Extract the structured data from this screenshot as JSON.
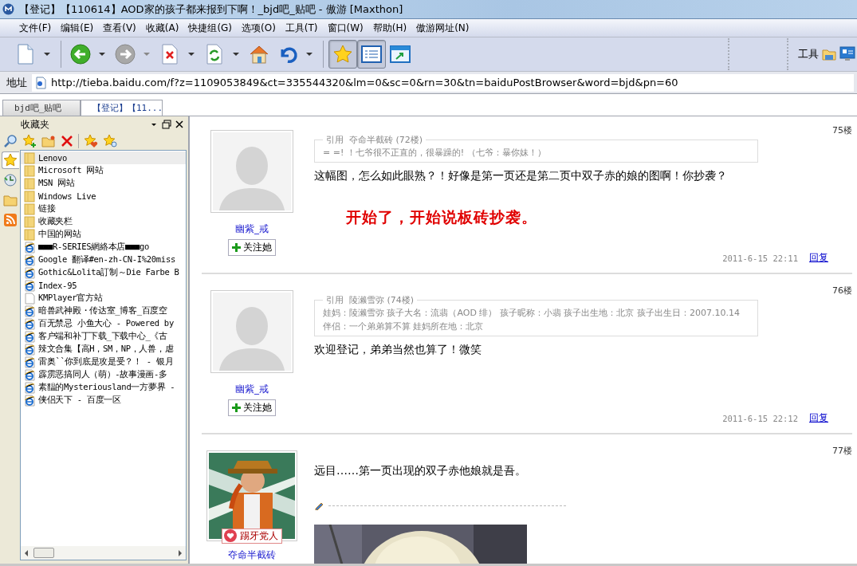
{
  "window": {
    "title": "【登记】【110614】AOD家的孩子都来报到下啊！_bjd吧_贴吧 - 傲游 [Maxthon]"
  },
  "menu": [
    "文件(F)",
    "编辑(E)",
    "查看(V)",
    "收藏(A)",
    "快捷组(G)",
    "选项(O)",
    "工具(T)",
    "窗口(W)",
    "帮助(H)",
    "傲游网址(N)"
  ],
  "toolbar": [
    {
      "kind": "new",
      "dropdown": true,
      "pressed": false,
      "separator": true
    },
    {
      "kind": "back",
      "dropdown": true,
      "pressed": false,
      "separator": false
    },
    {
      "kind": "forward",
      "dropdown": true,
      "pressed": false,
      "separator": false
    },
    {
      "kind": "stop",
      "dropdown": true,
      "pressed": false,
      "separator": false
    },
    {
      "kind": "refresh",
      "dropdown": true,
      "pressed": false,
      "separator": false
    },
    {
      "kind": "home",
      "dropdown": false,
      "pressed": false,
      "separator": false
    },
    {
      "kind": "undo",
      "dropdown": true,
      "pressed": false,
      "separator": true
    },
    {
      "kind": "favorites",
      "dropdown": false,
      "pressed": true,
      "separator": false
    },
    {
      "kind": "sidebar",
      "dropdown": false,
      "pressed": true,
      "separator": false
    },
    {
      "kind": "window",
      "dropdown": false,
      "pressed": false,
      "separator": false
    }
  ],
  "tools": {
    "label": "工具"
  },
  "address": {
    "label": "地址",
    "value": "http://tieba.baidu.com/f?z=1109053849&ct=335544320&lm=0&sc=0&rn=30&tn=baiduPostBrowser&word=bjd&pn=60"
  },
  "tabs": [
    {
      "label": "bjd吧_贴吧",
      "selected": false
    },
    {
      "label": "【登记】【11...",
      "selected": true
    }
  ],
  "sidebar": {
    "title": "收藏夹",
    "side_tabs": [
      {
        "kind": "favorites",
        "selected": true
      },
      {
        "kind": "history",
        "selected": false
      },
      {
        "kind": "folder",
        "selected": false
      },
      {
        "kind": "rss",
        "selected": false
      }
    ],
    "items": [
      {
        "label": "Lenovo",
        "kind": "folder",
        "selected": true
      },
      {
        "label": "Microsoft 网站",
        "kind": "folder",
        "selected": false
      },
      {
        "label": "MSN 网站",
        "kind": "folder",
        "selected": false
      },
      {
        "label": "Windows Live",
        "kind": "folder",
        "selected": false
      },
      {
        "label": "链接",
        "kind": "folder",
        "selected": false
      },
      {
        "label": "收藏夹栏",
        "kind": "folder",
        "selected": false
      },
      {
        "label": "中国的网站",
        "kind": "folder",
        "selected": false
      },
      {
        "label": "■■■R-SERIES網絡本店■■■go",
        "kind": "page",
        "selected": false
      },
      {
        "label": "Google 翻译#en-zh-CN-I%20miss",
        "kind": "page",
        "selected": false
      },
      {
        "label": "Gothic&Lolita訂制～Die Farbe B",
        "kind": "page",
        "selected": false
      },
      {
        "label": "Index-95",
        "kind": "page",
        "selected": false
      },
      {
        "label": "KMPlayer官方站",
        "kind": "blank",
        "selected": false
      },
      {
        "label": "暗兽武神殿・传达室_博客_百度空",
        "kind": "page",
        "selected": false
      },
      {
        "label": "百无禁忌 小鱼大心 - Powered by",
        "kind": "page",
        "selected": false
      },
      {
        "label": "客户端和补丁下载_下载中心_《古",
        "kind": "page",
        "selected": false
      },
      {
        "label": "辣文合集【高H，SM，NP，人兽，虐",
        "kind": "page",
        "selected": false
      },
      {
        "label": "雷奥``你到底是攻是受？！ - 银月",
        "kind": "page",
        "selected": false
      },
      {
        "label": "霹雳恶搞同人（萌）-故事漫画-多",
        "kind": "page",
        "selected": false
      },
      {
        "label": "素馧的Mysteriousland一方夢界 -",
        "kind": "page",
        "selected": false
      },
      {
        "label": "侠侣天下 - 百度一区",
        "kind": "page",
        "selected": false
      }
    ]
  },
  "posts": [
    {
      "floor": "75楼",
      "avatar": {
        "kind": "silhouette"
      },
      "author": "幽紫_戒",
      "follow": "关注她",
      "quote": {
        "title": "引用  夺命半截砖 (72楼)",
        "text": "= =! ！七爷很不正直的，很暴躁的! （七爷：暴你妹！）"
      },
      "text": "这幅图，怎么如此眼熟？！好像是第一页还是第二页中双子赤的娘的图啊！你抄袭？",
      "annotation": "开始了，开始说板砖抄袭。",
      "date": "2011-6-15 22:11",
      "reply": "回复"
    },
    {
      "floor": "76楼",
      "avatar": {
        "kind": "silhouette"
      },
      "author": "幽紫_戒",
      "follow": "关注她",
      "quote": {
        "title": "引用  陵濑雪弥 (74楼)",
        "text": "娃妈：陵濑雪弥 孩子大名：流翡（AOD 绯） 孩子昵称：小翡 孩子出生地：北京 孩子出生日：2007.10.14 伴侣：一个弟弟算不算 娃妈所在地：北京"
      },
      "text": "欢迎登记，弟弟当然也算了！微笑",
      "date": "2011-6-15 22:12",
      "reply": "回复"
    },
    {
      "floor": "77楼",
      "badge": "踢牙党人",
      "author": "夺命半截砖",
      "text": "远目……第一页出现的双子赤他娘就是吾。",
      "signature": true
    }
  ]
}
